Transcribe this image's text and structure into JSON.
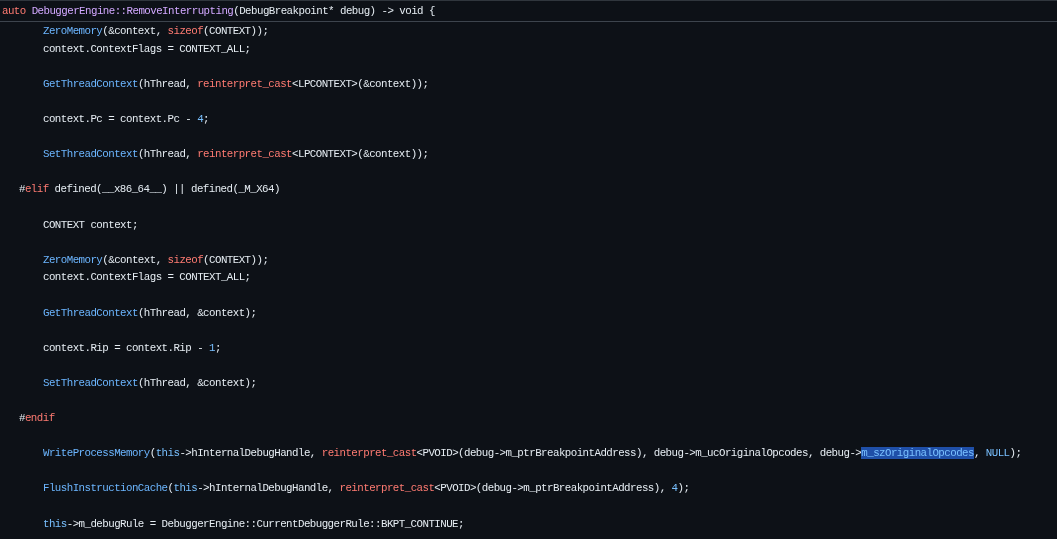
{
  "sticky_header": {
    "tokens": [
      {
        "text": "auto",
        "kind": "keyword"
      },
      {
        "text": "DebuggerEngine::RemoveInterrupting",
        "kind": "member"
      },
      {
        "text": "(DebugBreakpoint* debug) -> void {",
        "kind": "plain"
      }
    ]
  },
  "lines": [
    {
      "kind": "code",
      "tokens": [
        {
          "text": "ZeroMemory",
          "kind": "function"
        },
        {
          "text": "(&context, ",
          "kind": "plain"
        },
        {
          "text": "sizeof",
          "kind": "keyword"
        },
        {
          "text": "(CONTEXT));",
          "kind": "plain"
        }
      ]
    },
    {
      "kind": "code",
      "tokens": [
        {
          "text": "context.ContextFlags = CONTEXT_ALL;",
          "kind": "plain"
        }
      ]
    },
    {
      "kind": "blank"
    },
    {
      "kind": "code",
      "tokens": [
        {
          "text": "GetThreadContext",
          "kind": "function"
        },
        {
          "text": "(hThread, ",
          "kind": "plain"
        },
        {
          "text": "reinterpret_cast",
          "kind": "keyword"
        },
        {
          "text": "<LPCONTEXT>(&context));",
          "kind": "plain"
        }
      ]
    },
    {
      "kind": "blank"
    },
    {
      "kind": "code",
      "tokens": [
        {
          "text": "context.Pc = context.Pc - ",
          "kind": "plain"
        },
        {
          "text": "4",
          "kind": "number"
        },
        {
          "text": ";",
          "kind": "plain"
        }
      ]
    },
    {
      "kind": "blank"
    },
    {
      "kind": "code",
      "tokens": [
        {
          "text": "SetThreadContext",
          "kind": "function"
        },
        {
          "text": "(hThread, ",
          "kind": "plain"
        },
        {
          "text": "reinterpret_cast",
          "kind": "keyword"
        },
        {
          "text": "<LPCONTEXT>(&context));",
          "kind": "plain"
        }
      ]
    },
    {
      "kind": "blank"
    },
    {
      "kind": "directive",
      "tokens": [
        {
          "text": "#",
          "kind": "plain"
        },
        {
          "text": "elif",
          "kind": "keyword"
        },
        {
          "text": " defined(__x86_64__) || defined(_M_X64)",
          "kind": "plain"
        }
      ]
    },
    {
      "kind": "blank"
    },
    {
      "kind": "code",
      "tokens": [
        {
          "text": "CONTEXT context;",
          "kind": "plain"
        }
      ]
    },
    {
      "kind": "blank"
    },
    {
      "kind": "code",
      "tokens": [
        {
          "text": "ZeroMemory",
          "kind": "function"
        },
        {
          "text": "(&context, ",
          "kind": "plain"
        },
        {
          "text": "sizeof",
          "kind": "keyword"
        },
        {
          "text": "(CONTEXT));",
          "kind": "plain"
        }
      ]
    },
    {
      "kind": "code",
      "tokens": [
        {
          "text": "context.ContextFlags = CONTEXT_ALL;",
          "kind": "plain"
        }
      ]
    },
    {
      "kind": "blank"
    },
    {
      "kind": "code",
      "tokens": [
        {
          "text": "GetThreadContext",
          "kind": "function"
        },
        {
          "text": "(hThread, &context);",
          "kind": "plain"
        }
      ]
    },
    {
      "kind": "blank"
    },
    {
      "kind": "code",
      "tokens": [
        {
          "text": "context.Rip = context.Rip - ",
          "kind": "plain"
        },
        {
          "text": "1",
          "kind": "number"
        },
        {
          "text": ";",
          "kind": "plain"
        }
      ]
    },
    {
      "kind": "blank"
    },
    {
      "kind": "code",
      "tokens": [
        {
          "text": "SetThreadContext",
          "kind": "function"
        },
        {
          "text": "(hThread, &context);",
          "kind": "plain"
        }
      ]
    },
    {
      "kind": "blank"
    },
    {
      "kind": "directive",
      "tokens": [
        {
          "text": "#",
          "kind": "plain"
        },
        {
          "text": "endif",
          "kind": "keyword"
        }
      ]
    },
    {
      "kind": "blank"
    },
    {
      "kind": "code",
      "tokens": [
        {
          "text": "WriteProcessMemory",
          "kind": "function"
        },
        {
          "text": "(",
          "kind": "plain"
        },
        {
          "text": "this",
          "kind": "number"
        },
        {
          "text": "->hInternalDebugHandle, ",
          "kind": "plain"
        },
        {
          "text": "reinterpret_cast",
          "kind": "keyword"
        },
        {
          "text": "<PVOID>(debug->m_ptrBreakpointAddress), debug->m_ucOriginalOpcodes, debug->",
          "kind": "plain"
        },
        {
          "text": "m_szOriginalOpcodes",
          "kind": "selection"
        },
        {
          "text": ", ",
          "kind": "plain"
        },
        {
          "text": "NULL",
          "kind": "number"
        },
        {
          "text": ");",
          "kind": "plain"
        }
      ]
    },
    {
      "kind": "blank"
    },
    {
      "kind": "code",
      "tokens": [
        {
          "text": "FlushInstructionCache",
          "kind": "function"
        },
        {
          "text": "(",
          "kind": "plain"
        },
        {
          "text": "this",
          "kind": "number"
        },
        {
          "text": "->hInternalDebugHandle, ",
          "kind": "plain"
        },
        {
          "text": "reinterpret_cast",
          "kind": "keyword"
        },
        {
          "text": "<PVOID>(debug->m_ptrBreakpointAddress), ",
          "kind": "plain"
        },
        {
          "text": "4",
          "kind": "number"
        },
        {
          "text": ");",
          "kind": "plain"
        }
      ]
    },
    {
      "kind": "blank"
    },
    {
      "kind": "code",
      "tokens": [
        {
          "text": "this",
          "kind": "number"
        },
        {
          "text": "->m_debugRule = DebuggerEngine::CurrentDebuggerRule::BKPT_CONTINUE;",
          "kind": "plain"
        }
      ]
    }
  ]
}
